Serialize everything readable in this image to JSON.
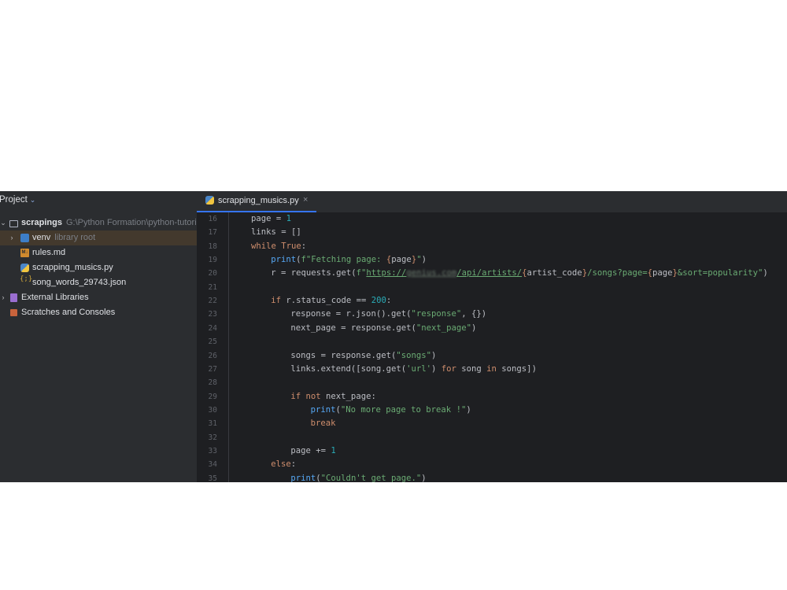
{
  "project": {
    "title": "Project",
    "tree": [
      {
        "label": "scrapings",
        "hint": "G:\\Python Formation\\python-tutorial",
        "icon": "folder-icon",
        "bold": true,
        "expanded": true
      },
      {
        "label": "venv",
        "hint": "library root",
        "icon": "venv-folder-icon",
        "bold": false,
        "selected": true
      },
      {
        "label": "rules.md",
        "icon": "markdown-file-icon"
      },
      {
        "label": "scrapping_musics.py",
        "icon": "python-file-icon"
      },
      {
        "label": "song_words_29743.json",
        "icon": "json-file-icon"
      },
      {
        "label": "External Libraries",
        "icon": "library-icon"
      },
      {
        "label": "Scratches and Consoles",
        "icon": "scratches-icon"
      }
    ]
  },
  "editor": {
    "tab": {
      "label": "scrapping_musics.py",
      "close": "×"
    },
    "lines": [
      {
        "n": "16",
        "indent": 0,
        "tokens": [
          {
            "t": "page = ",
            "c": "plain"
          },
          {
            "t": "1",
            "c": "num"
          }
        ]
      },
      {
        "n": "17",
        "indent": 0,
        "tokens": [
          {
            "t": "links = []",
            "c": "plain"
          }
        ]
      },
      {
        "n": "18",
        "indent": 0,
        "tokens": [
          {
            "t": "while ",
            "c": "kw"
          },
          {
            "t": "True",
            "c": "kw"
          },
          {
            "t": ":",
            "c": "plain"
          }
        ]
      },
      {
        "n": "19",
        "indent": 1,
        "tokens": [
          {
            "t": "print",
            "c": "fn"
          },
          {
            "t": "(",
            "c": "plain"
          },
          {
            "t": "f\"Fetching page: ",
            "c": "str"
          },
          {
            "t": "{",
            "c": "br"
          },
          {
            "t": "page",
            "c": "plain"
          },
          {
            "t": "}",
            "c": "br"
          },
          {
            "t": "\"",
            "c": "str"
          },
          {
            "t": ")",
            "c": "plain"
          }
        ]
      },
      {
        "n": "20",
        "indent": 1,
        "tokens": [
          {
            "t": "r = requests.get(",
            "c": "plain"
          },
          {
            "t": "f\"",
            "c": "str"
          },
          {
            "t": "https://",
            "c": "url"
          },
          {
            "t": "genius.com",
            "c": "blur"
          },
          {
            "t": "/api/artists/",
            "c": "url"
          },
          {
            "t": "{",
            "c": "br"
          },
          {
            "t": "artist_code",
            "c": "plain"
          },
          {
            "t": "}",
            "c": "br"
          },
          {
            "t": "/songs?page=",
            "c": "str"
          },
          {
            "t": "{",
            "c": "br"
          },
          {
            "t": "page",
            "c": "plain"
          },
          {
            "t": "}",
            "c": "br"
          },
          {
            "t": "&sort=popularity\"",
            "c": "str"
          },
          {
            "t": ")",
            "c": "plain"
          }
        ]
      },
      {
        "n": "21",
        "indent": 0,
        "tokens": []
      },
      {
        "n": "22",
        "indent": 1,
        "tokens": [
          {
            "t": "if ",
            "c": "kw"
          },
          {
            "t": "r.status_code == ",
            "c": "plain"
          },
          {
            "t": "200",
            "c": "num"
          },
          {
            "t": ":",
            "c": "plain"
          }
        ]
      },
      {
        "n": "23",
        "indent": 2,
        "tokens": [
          {
            "t": "response = r.json().get(",
            "c": "plain"
          },
          {
            "t": "\"response\"",
            "c": "str"
          },
          {
            "t": ", {})",
            "c": "plain"
          }
        ]
      },
      {
        "n": "24",
        "indent": 2,
        "tokens": [
          {
            "t": "next_page = response.get(",
            "c": "plain"
          },
          {
            "t": "\"next_page\"",
            "c": "str"
          },
          {
            "t": ")",
            "c": "plain"
          }
        ]
      },
      {
        "n": "25",
        "indent": 0,
        "tokens": []
      },
      {
        "n": "26",
        "indent": 2,
        "tokens": [
          {
            "t": "songs = response.get(",
            "c": "plain"
          },
          {
            "t": "\"songs\"",
            "c": "str"
          },
          {
            "t": ")",
            "c": "plain"
          }
        ]
      },
      {
        "n": "27",
        "indent": 2,
        "tokens": [
          {
            "t": "links.extend([song.get(",
            "c": "plain"
          },
          {
            "t": "'url'",
            "c": "str"
          },
          {
            "t": ") ",
            "c": "plain"
          },
          {
            "t": "for ",
            "c": "kw"
          },
          {
            "t": "song ",
            "c": "plain"
          },
          {
            "t": "in ",
            "c": "kw"
          },
          {
            "t": "songs])",
            "c": "plain"
          }
        ]
      },
      {
        "n": "28",
        "indent": 0,
        "tokens": []
      },
      {
        "n": "29",
        "indent": 2,
        "tokens": [
          {
            "t": "if not ",
            "c": "kw"
          },
          {
            "t": "next_page:",
            "c": "plain"
          }
        ]
      },
      {
        "n": "30",
        "indent": 3,
        "tokens": [
          {
            "t": "print",
            "c": "fn"
          },
          {
            "t": "(",
            "c": "plain"
          },
          {
            "t": "\"No more page to break !\"",
            "c": "str"
          },
          {
            "t": ")",
            "c": "plain"
          }
        ]
      },
      {
        "n": "31",
        "indent": 3,
        "tokens": [
          {
            "t": "break",
            "c": "kw"
          }
        ]
      },
      {
        "n": "32",
        "indent": 0,
        "tokens": []
      },
      {
        "n": "33",
        "indent": 2,
        "tokens": [
          {
            "t": "page += ",
            "c": "plain"
          },
          {
            "t": "1",
            "c": "num"
          }
        ]
      },
      {
        "n": "34",
        "indent": 1,
        "tokens": [
          {
            "t": "else",
            "c": "kw"
          },
          {
            "t": ":",
            "c": "plain"
          }
        ]
      },
      {
        "n": "35",
        "indent": 2,
        "tokens": [
          {
            "t": "print",
            "c": "fn"
          },
          {
            "t": "(",
            "c": "plain"
          },
          {
            "t": "\"Couldn't get page.\"",
            "c": "str"
          },
          {
            "t": ")",
            "c": "plain"
          }
        ]
      }
    ]
  }
}
